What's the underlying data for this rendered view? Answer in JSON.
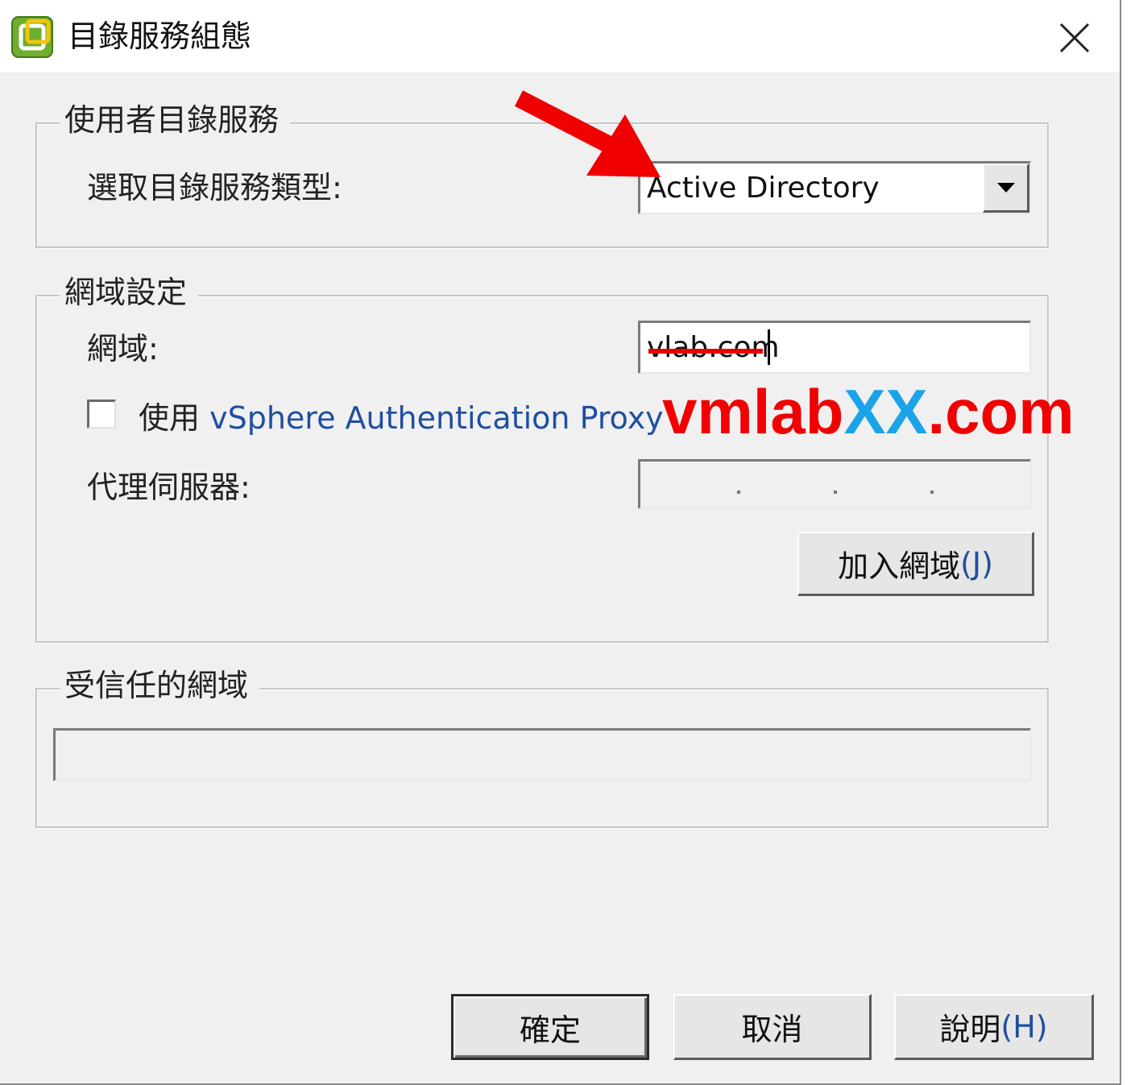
{
  "window": {
    "title": "目錄服務組態",
    "icons": {
      "app": "vsphere-client-icon",
      "close": "close-icon"
    }
  },
  "user_directory": {
    "legend": "使用者目錄服務",
    "type_label": "選取目錄服務類型:",
    "type_value": "Active Directory"
  },
  "domain_settings": {
    "legend": "網域設定",
    "domain_label": "網域:",
    "domain_value": "vlab.com",
    "proxy_checkbox_prefix": "使用",
    "proxy_checkbox_label": "vSphere Authentication Proxy",
    "proxy_checked": false,
    "proxy_server_label": "代理伺服器:",
    "join_button_text": "加入網域",
    "join_button_mnemonic": "(J)"
  },
  "trusted_domains": {
    "legend": "受信任的網域"
  },
  "buttons": {
    "ok": "確定",
    "cancel": "取消",
    "help_text": "說明",
    "help_mnemonic": "(H)"
  },
  "watermark": {
    "prefix": "vmlab",
    "highlight": "XX",
    "suffix": ".com"
  },
  "colors": {
    "annotation_red": "#f00000",
    "watermark_blue": "#1aa3e8",
    "dialog_bg": "#f0f0f0"
  }
}
